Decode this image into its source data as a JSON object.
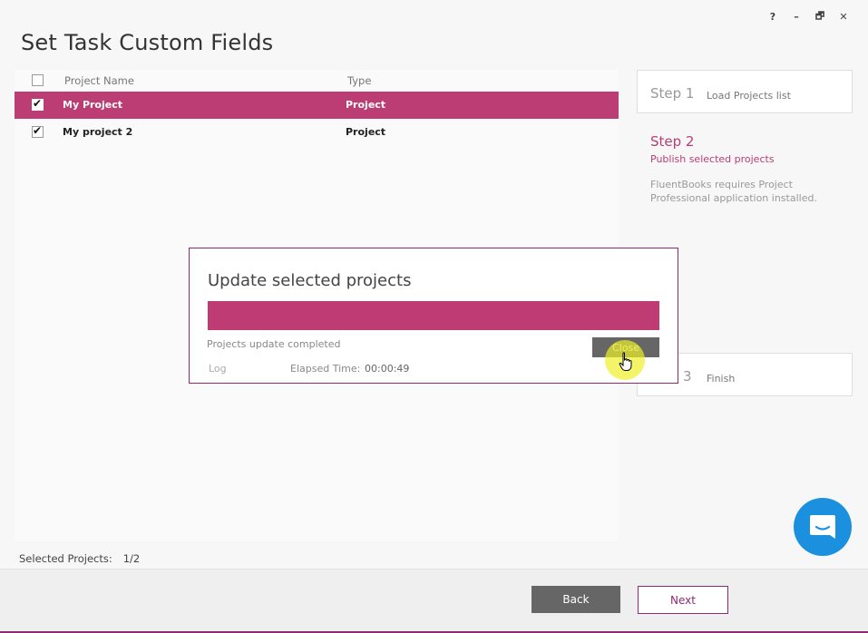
{
  "window": {
    "controls": {
      "help": "?",
      "minimize": "–",
      "restore": "🗗",
      "close": "✕"
    }
  },
  "header": {
    "title": "Set Task Custom Fields"
  },
  "table": {
    "columns": {
      "name": "Project Name",
      "type": "Type"
    },
    "rows": [
      {
        "name": "My Project",
        "type": "Project",
        "checked": true,
        "selected": true
      },
      {
        "name": "My project 2",
        "type": "Project",
        "checked": true,
        "selected": false
      }
    ]
  },
  "footer": {
    "selected_label": "Selected Projects:",
    "selected_value": "1/2"
  },
  "steps": {
    "step1": {
      "num": "Step 1",
      "label": "Load Projects list"
    },
    "step2": {
      "num": "Step 2",
      "label": "Publish selected projects",
      "note": "FluentBooks requires Project Professional application installed."
    },
    "step3": {
      "num": "3",
      "label": "Finish"
    }
  },
  "modal": {
    "title": "Update selected projects",
    "progress": 100,
    "status": "Projects update completed",
    "close_label": "Close",
    "log_label": "Log",
    "elapsed_label": "Elapsed Time:",
    "elapsed_value": "00:00:49"
  },
  "nav": {
    "back_label": "Back",
    "next_label": "Next"
  },
  "colors": {
    "accent": "#bc3d74",
    "border_accent": "#8e2a71",
    "chat": "#1a90de",
    "button_dark": "#666666"
  },
  "icons": {
    "chat": "chat-bubble-icon",
    "cursor": "hand-pointer-icon"
  }
}
